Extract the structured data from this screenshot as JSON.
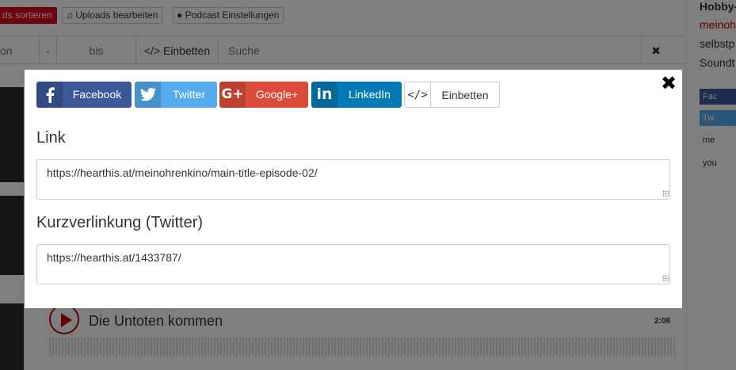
{
  "background": {
    "toolbar": {
      "sort_label": "ds sortieren",
      "uploads_label": "♫ Uploads bearbeiten",
      "podcast_label": "Podcast Einstellungen"
    },
    "filter_bar": {
      "cells": [
        "on",
        "-",
        "bis",
        "</> Einbetten",
        "Suche"
      ],
      "clear_icon": "times-icon"
    },
    "track": {
      "title": "Die Untoten kommen",
      "duration": "2:08"
    },
    "sidebar": {
      "heading": "Hobby-",
      "link": "meinoh",
      "lines": [
        "selbstp",
        "Soundt"
      ],
      "share_items": [
        "Fac",
        "Tw",
        "me",
        "you"
      ]
    }
  },
  "modal": {
    "close_icon": "close-icon",
    "share_buttons": [
      {
        "label": "Facebook",
        "icon": "facebook-icon",
        "color": "#3b5998"
      },
      {
        "label": "Twitter",
        "icon": "twitter-icon",
        "color": "#55acee"
      },
      {
        "label": "Google+",
        "icon": "google-plus-icon",
        "color": "#dd4b39"
      },
      {
        "label": "LinkedIn",
        "icon": "linkedin-icon",
        "color": "#007bb6"
      },
      {
        "label": "Einbetten",
        "icon": "code-icon",
        "color": "#ffffff"
      }
    ],
    "link": {
      "label": "Link",
      "value": "https://hearthis.at/meinohrenkino/main-title-episode-02/"
    },
    "short_link": {
      "label": "Kurzverlinkung (Twitter)",
      "value": "https://hearthis.at/1433787/"
    }
  }
}
